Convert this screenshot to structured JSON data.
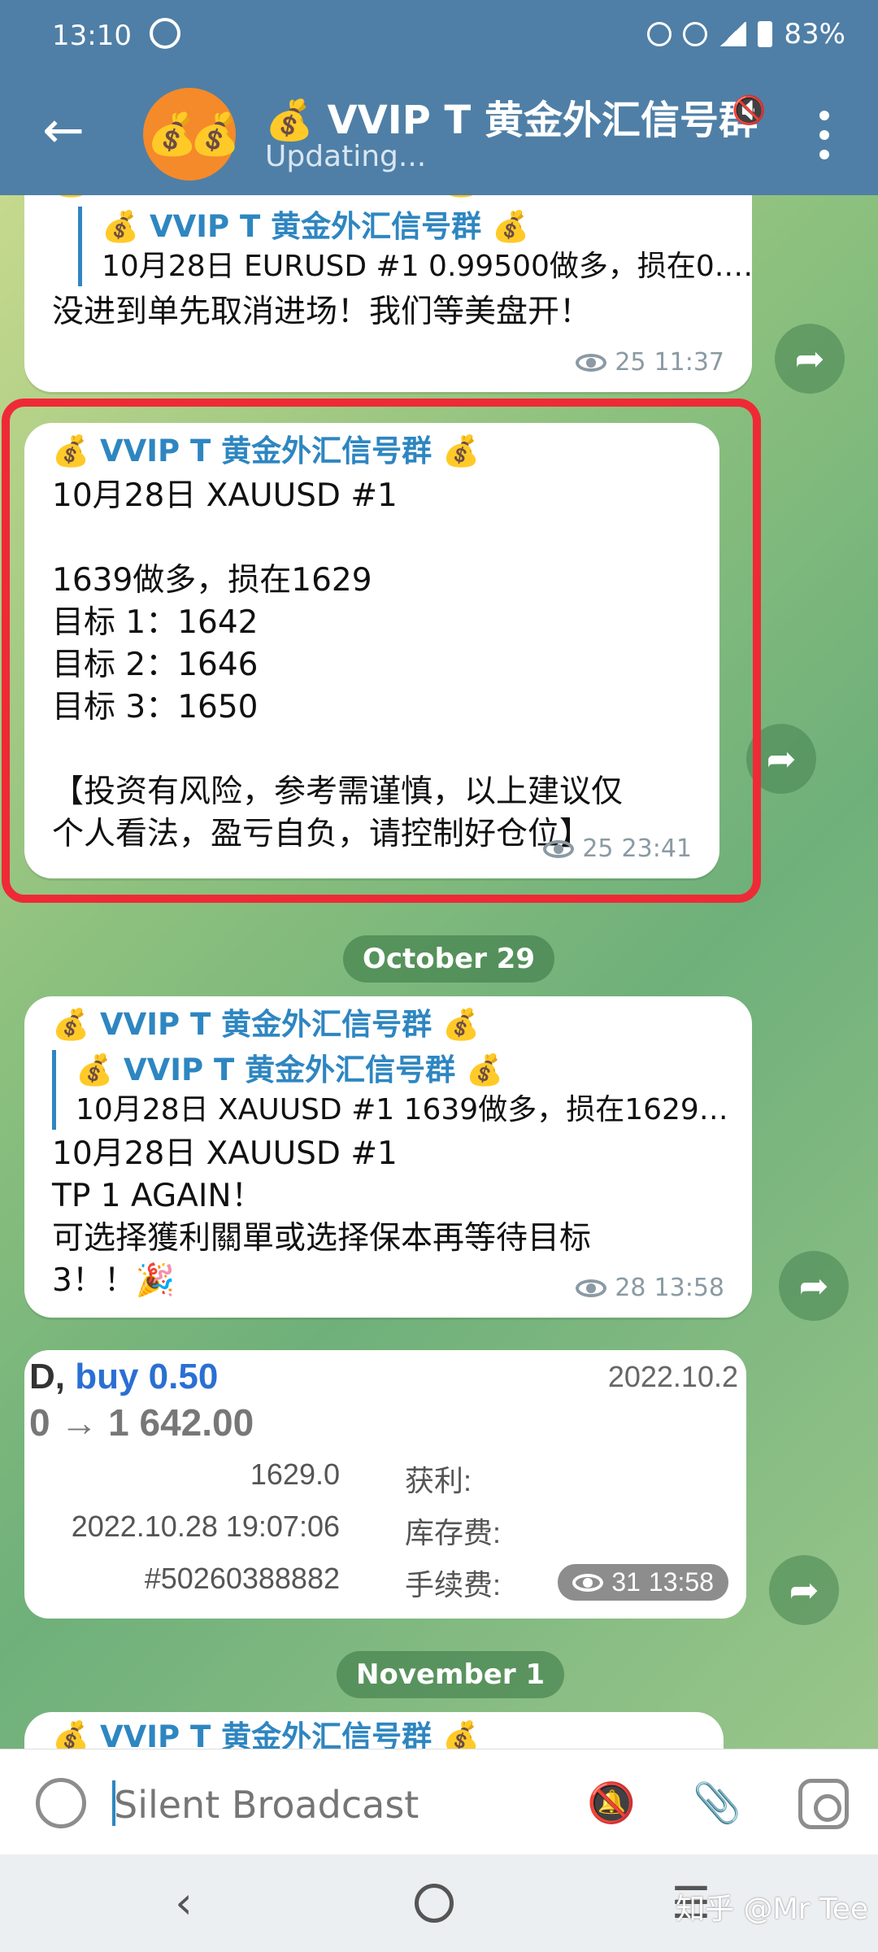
{
  "status": {
    "time": "13:10",
    "battery": "83%"
  },
  "header": {
    "avatar": "💰💰",
    "title": "💰 VVIP T 黄金外汇信号群",
    "subtitle": "Updating..."
  },
  "messages": [
    {
      "sender": "💰 VVIP T 黄金外汇信号群 💰",
      "quote_sender": "💰 VVIP T 黄金外汇信号群 💰",
      "quote_text": "10月28日 EURUSD  #1  0.99500做多，损在0.…",
      "text": "没进到单先取消进场！我们等美盘开！",
      "views": "25",
      "time": "11:37"
    },
    {
      "sender": "💰 VVIP T 黄金外汇信号群 💰",
      "lines": [
        "10月28日 XAUUSD  #1",
        "",
        "1639做多，损在1629",
        "目标 1：1642",
        "目标 2：1646",
        "目标 3：1650",
        "",
        "【投资有风险，参考需谨慎，以上建议仅",
        "个人看法，盈亏自负，请控制好仓位】"
      ],
      "views": "25",
      "time": "23:41"
    },
    {
      "sender": "💰 VVIP T 黄金外汇信号群 💰",
      "quote_sender": "💰 VVIP T 黄金外汇信号群 💰",
      "quote_text": "10月28日 XAUUSD  #1  1639做多，损在1629…",
      "lines": [
        "10月28日 XAUUSD  #1",
        "TP 1 AGAIN！",
        "可选择獲利關單或选择保本再等待目标",
        "3！！🎉"
      ],
      "views": "28",
      "time": "13:58"
    },
    {
      "receipt": {
        "buy_prefix": "D,",
        "buy": "buy 0.50",
        "date": "2022.10.2",
        "price": "0 → 1 642.00",
        "rows": [
          {
            "value": "1629.0",
            "label": "获利:"
          },
          {
            "value": "2022.10.28 19:07:06",
            "label": "库存费:"
          },
          {
            "value": "#50260388882",
            "label": "手续费:"
          }
        ]
      },
      "views": "31",
      "time": "13:58"
    },
    {
      "sender": "💰 VVIP T 黄金外汇信号群 💰"
    }
  ],
  "dates": [
    "October 29",
    "November 1"
  ],
  "input": {
    "placeholder": "Silent Broadcast"
  },
  "watermark": "知乎 @Mr Tee"
}
